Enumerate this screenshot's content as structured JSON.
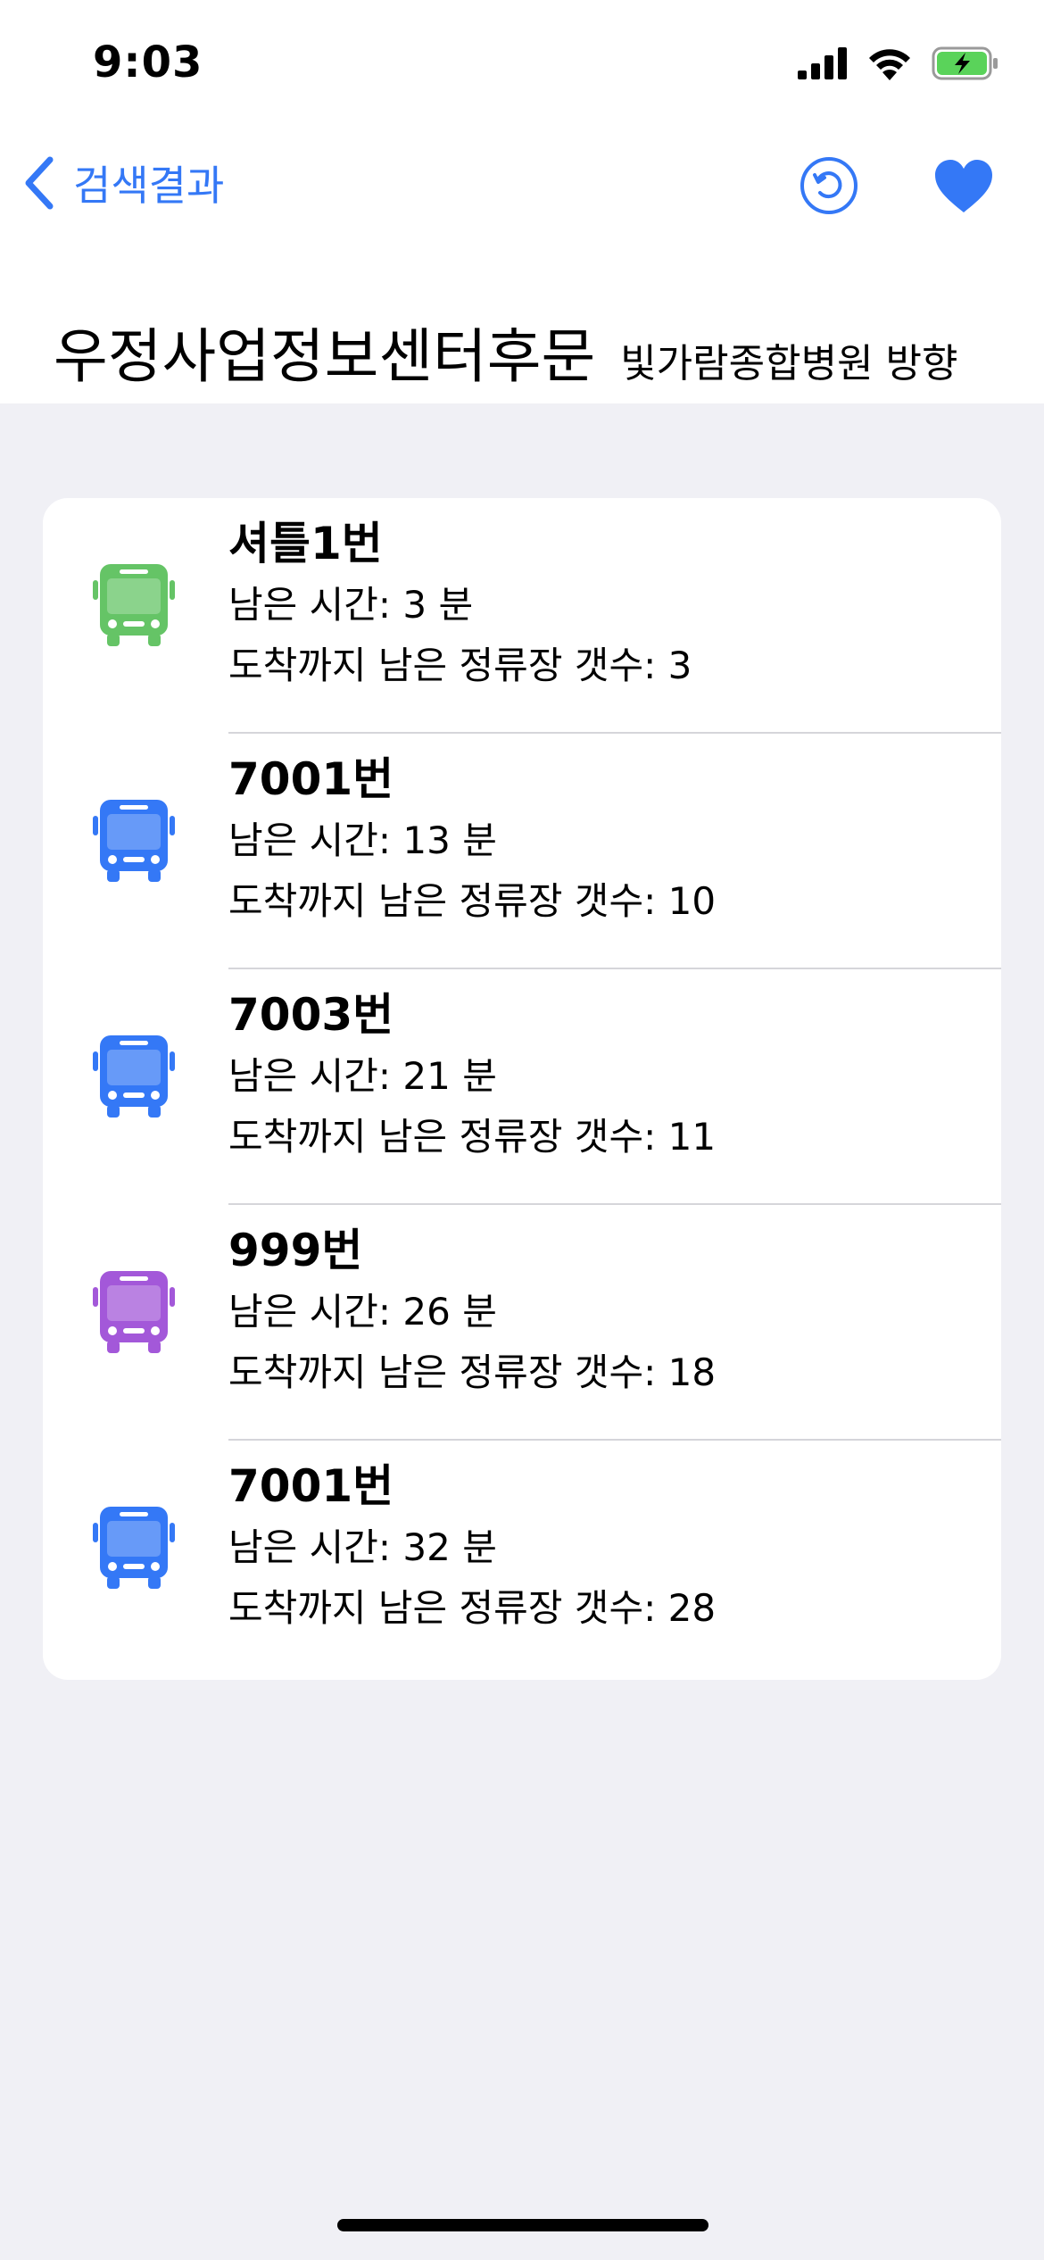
{
  "status_bar": {
    "time": "9:03"
  },
  "nav": {
    "back_label": "검색결과"
  },
  "stop": {
    "name": "우정사업정보센터후문",
    "direction": "빛가람종합병원 방향"
  },
  "colors": {
    "accent": "#3478f6",
    "shuttle_green": "#65c466",
    "city_blue": "#3478f6",
    "express_purple": "#a358d9",
    "battery_green": "#5ad35a"
  },
  "buses": [
    {
      "route": "셔틀1번",
      "time_left": "남은 시간: 3 분",
      "stops_left": "도착까지 남은 정류장 갯수: 3",
      "icon": "bus-icon",
      "color": "#65c466"
    },
    {
      "route": "7001번",
      "time_left": "남은 시간: 13 분",
      "stops_left": "도착까지 남은 정류장 갯수: 10",
      "icon": "bus-icon",
      "color": "#3478f6"
    },
    {
      "route": "7003번",
      "time_left": "남은 시간: 21 분",
      "stops_left": "도착까지 남은 정류장 갯수: 11",
      "icon": "bus-icon",
      "color": "#3478f6"
    },
    {
      "route": "999번",
      "time_left": "남은 시간: 26 분",
      "stops_left": "도착까지 남은 정류장 갯수: 18",
      "icon": "bus-icon",
      "color": "#a358d9"
    },
    {
      "route": "7001번",
      "time_left": "남은 시간: 32 분",
      "stops_left": "도착까지 남은 정류장 갯수: 28",
      "icon": "bus-icon",
      "color": "#3478f6"
    }
  ]
}
